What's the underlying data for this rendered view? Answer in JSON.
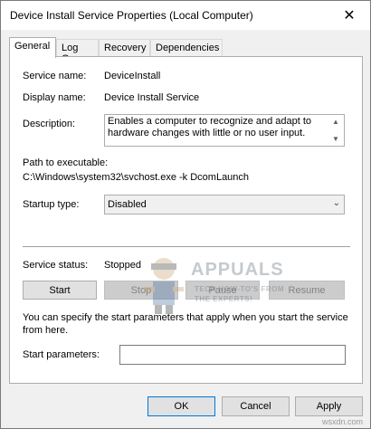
{
  "window": {
    "title": "Device Install Service Properties (Local Computer)",
    "close_glyph": "✕"
  },
  "tabs": [
    {
      "label": "General",
      "active": true
    },
    {
      "label": "Log On"
    },
    {
      "label": "Recovery"
    },
    {
      "label": "Dependencies"
    }
  ],
  "general": {
    "service_name_label": "Service name:",
    "service_name_value": "DeviceInstall",
    "display_name_label": "Display name:",
    "display_name_value": "Device Install Service",
    "description_label": "Description:",
    "description_value": "Enables a computer to recognize and adapt to hardware changes with little or no user input.",
    "path_label": "Path to executable:",
    "path_value": "C:\\Windows\\system32\\svchost.exe -k DcomLaunch",
    "startup_type_label": "Startup type:",
    "startup_type_value": "Disabled",
    "service_status_label": "Service status:",
    "service_status_value": "Stopped",
    "buttons": {
      "start": "Start",
      "stop": "Stop",
      "pause": "Pause",
      "resume": "Resume"
    },
    "params_hint": "You can specify the start parameters that apply when you start the service from here.",
    "start_params_label": "Start parameters:",
    "start_params_value": ""
  },
  "footer": {
    "ok": "OK",
    "cancel": "Cancel",
    "apply": "Apply"
  },
  "watermark": {
    "brand": "APPUALS",
    "tagline1": "TECH HOW-TO'S FROM",
    "tagline2": "THE EXPERTS!",
    "site": "wsxdn.com"
  },
  "icons": {
    "close": "close-icon",
    "scroll_up": "scroll-up-icon",
    "scroll_down": "scroll-down-icon",
    "dropdown": "chevron-down-icon"
  },
  "colors": {
    "accent": "#0078d7",
    "dialog_bg": "#f0f0f0",
    "disabled_text": "#838383"
  }
}
